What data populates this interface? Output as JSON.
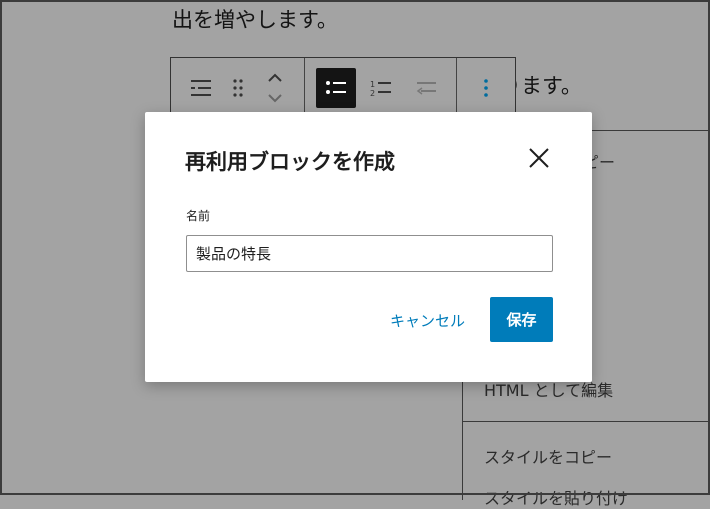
{
  "background": {
    "paragraph_line1": "出を増やします。",
    "paragraph_line2": "ります。",
    "menu": {
      "partial_top": "ピー",
      "html_edit": "HTML として編集",
      "copy_style": "スタイルをコピー",
      "paste_style_partial": "スタイルを貼り付け"
    }
  },
  "toolbar": {
    "buttons": [
      "list-view-icon",
      "drag-handle-icon",
      "move-up-down-icon",
      "unordered-list-icon",
      "ordered-list-icon",
      "outdent-icon",
      "more-options-icon"
    ]
  },
  "modal": {
    "title": "再利用ブロックを作成",
    "name_label": "名前",
    "name_value": "製品の特長",
    "cancel_label": "キャンセル",
    "save_label": "保存"
  },
  "colors": {
    "accent": "#007cba",
    "overlay": "#a3a3a3"
  }
}
